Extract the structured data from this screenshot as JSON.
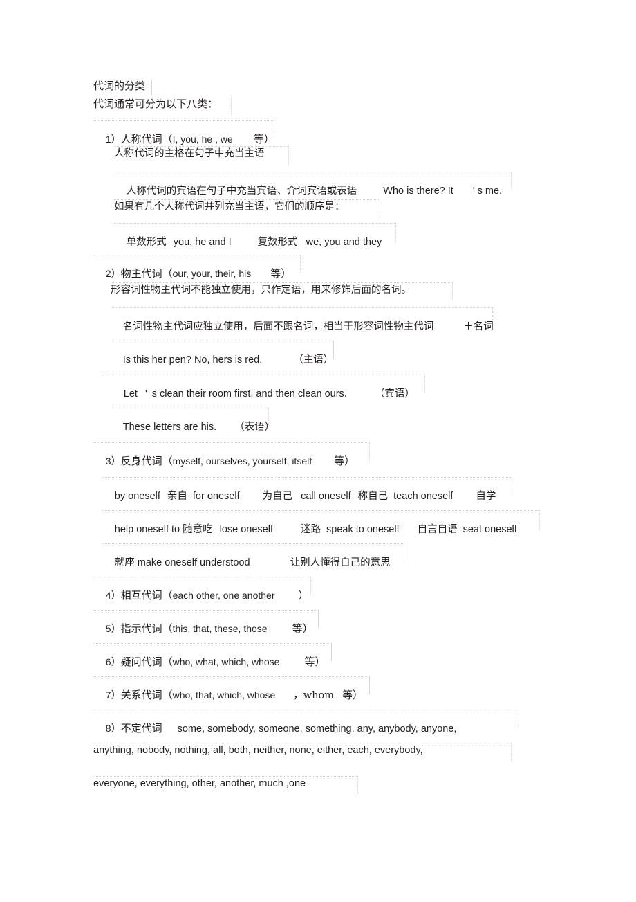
{
  "document": {
    "title": "代词的分类",
    "intro": "代词通常可分为以下八类："
  },
  "sections": [
    {
      "id": "personal-pronouns",
      "heading_number": "1）",
      "heading_cn": "人称代词（",
      "heading_examples": "I, you, he , we",
      "heading_suffix": "等）",
      "lines": [
        {
          "id": "subject-rule",
          "text": "人称代词的主格在句子中充当主语"
        },
        {
          "id": "object-rule",
          "text": "人称代词的宾语在句子中充当宾语、介词宾语或表语",
          "example": "Who is there? It",
          "example_tail": "' s me."
        },
        {
          "id": "order-rule",
          "text": "如果有几个人称代词并列充当主语，它们的顺序是："
        },
        {
          "id": "order-forms",
          "singular_label": "单数形式",
          "singular_value": "you, he and I",
          "plural_label": "复数形式",
          "plural_value": "we, you and they"
        }
      ]
    },
    {
      "id": "possessive-pronouns",
      "heading_number": "2）",
      "heading_cn": "物主代词（",
      "heading_examples": "our, your, their, his",
      "heading_suffix": "等）",
      "lines": [
        {
          "id": "adjectival-rule",
          "text": "形容词性物主代词不能独立使用，只作定语，用来修饰后面的名词。"
        },
        {
          "id": "nominal-rule",
          "text": "名词性物主代词应独立使用，后面不跟名词，相当于形容词性物主代词",
          "tail": "＋名词"
        }
      ],
      "examples": [
        {
          "id": "example-subject",
          "sentence": "Is this her pen? No, hers is red.",
          "role": "（主语）"
        },
        {
          "id": "example-object",
          "sentence_head": "Let",
          "apostrophe": "'",
          "sentence_tail": "s clean their room first, and then clean ours.",
          "role": "（宾语）"
        },
        {
          "id": "example-predicative",
          "sentence": "These letters are his.",
          "role": "（表语）"
        }
      ]
    },
    {
      "id": "reflexive-pronouns",
      "heading_number": "3）",
      "heading_cn": "反身代词（",
      "heading_examples": "myself, ourselves, yourself, itself",
      "heading_suffix": "等）",
      "phrase_rows": [
        {
          "id": "reflexive-row-1",
          "items": [
            {
              "en": "by oneself",
              "cn": "亲自"
            },
            {
              "en": "for oneself",
              "cn": "为自己"
            },
            {
              "en": "call oneself",
              "cn": "称自己"
            },
            {
              "en": "teach oneself",
              "cn": "自学"
            }
          ]
        },
        {
          "id": "reflexive-row-2",
          "items": [
            {
              "en": "help oneself to",
              "cn": "随意吃"
            },
            {
              "en": "lose oneself",
              "cn": "迷路"
            },
            {
              "en": "speak to oneself",
              "cn": "自言自语"
            },
            {
              "en": "seat oneself",
              "cn": ""
            }
          ]
        },
        {
          "id": "reflexive-row-3",
          "items": [
            {
              "cn": "就座",
              "en": "make oneself understood"
            },
            {
              "cn": "让别人懂得自己的意思",
              "en": ""
            }
          ]
        }
      ]
    },
    {
      "id": "reciprocal-pronouns",
      "heading_number": "4）",
      "heading_cn": "相互代词（",
      "heading_examples": "each other, one another",
      "heading_suffix": "）"
    },
    {
      "id": "demonstrative-pronouns",
      "heading_number": "5）",
      "heading_cn": "指示代词（",
      "heading_examples": "this, that, these, those",
      "heading_suffix": "等）"
    },
    {
      "id": "interrogative-pronouns",
      "heading_number": "6）",
      "heading_cn": "疑问代词（",
      "heading_examples": "who, what, which, whose",
      "heading_suffix": "等）"
    },
    {
      "id": "relative-pronouns",
      "heading_number": "7）",
      "heading_cn": "关系代词（",
      "heading_examples": "who, that, which, whose",
      "heading_suffix": "，whom",
      "heading_suffix2": "等）"
    },
    {
      "id": "indefinite-pronouns",
      "heading_number": "8）",
      "heading_cn": "不定代词",
      "list_lines": [
        "some, somebody, someone, something, any, anybody, anyone,",
        "anything, nobody, nothing, all, both, neither, none, either, each, everybody,",
        "everyone, everything, other, another, much ,one"
      ]
    }
  ],
  "reflexive_line_1": {
    "a_en": "by oneself",
    "a_cn": "亲自",
    "b_en": "for oneself",
    "b_cn": "为自己",
    "c_en": "call oneself",
    "c_cn": "称自己",
    "d_en": "teach oneself",
    "d_cn": "自学"
  },
  "reflexive_line_2": {
    "a_en": "help oneself to",
    "a_cn": "随意吃",
    "b_en": "lose oneself",
    "b_cn": "迷路",
    "c_en": "speak to oneself",
    "c_cn": "自言自语",
    "d_en": "seat oneself"
  },
  "reflexive_line_3": {
    "a_cn": "就座",
    "a_en": "make oneself understood",
    "b_cn": "让别人懂得自己的意思"
  },
  "colors": {
    "text": "#231f20",
    "frame_rule": "#cfcfcf",
    "page_background": "#ffffff"
  }
}
